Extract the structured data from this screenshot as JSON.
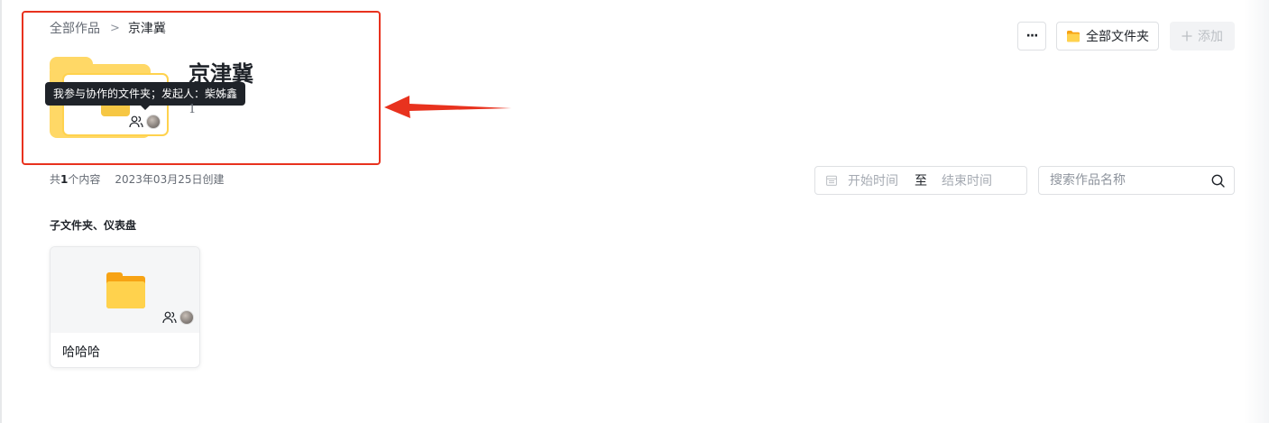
{
  "breadcrumb": {
    "root": "全部作品",
    "separator": ">",
    "current": "京津冀"
  },
  "folder": {
    "title": "京津冀",
    "tooltip": "我参与协作的文件夹；发起人：柴姊鑫",
    "count": "1"
  },
  "toolbar": {
    "more_label": "···",
    "all_folders_label": "全部文件夹",
    "add_label": "添加"
  },
  "meta": {
    "count_prefix": "共",
    "count_value": "1",
    "count_suffix": "个内容",
    "created": "2023年03月25日创建"
  },
  "filters": {
    "date_start_placeholder": "开始时间",
    "date_separator": "至",
    "date_end_placeholder": "结束时间",
    "search_placeholder": "搜索作品名称"
  },
  "section": {
    "title": "子文件夹、仪表盘"
  },
  "items": [
    {
      "name": "哈哈哈",
      "icon": "folder-icon"
    }
  ],
  "colors": {
    "accent_red": "#e8321e",
    "folder_yellow": "#ffd866",
    "folder_orange": "#f7a314"
  }
}
